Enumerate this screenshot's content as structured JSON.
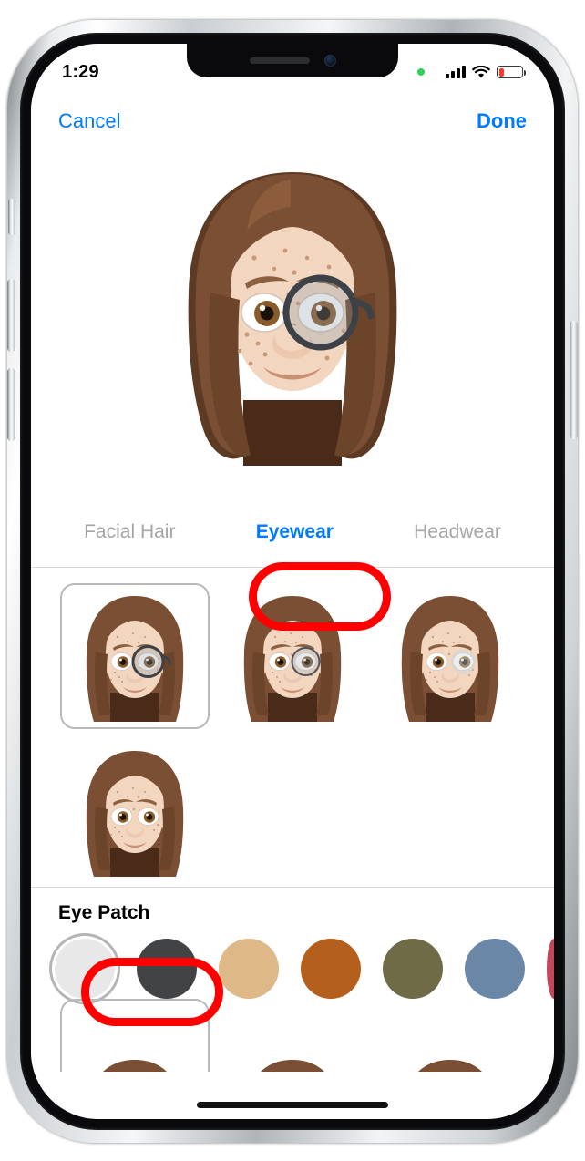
{
  "status_bar": {
    "time": "1:29",
    "recording_dot": "recording-indicator-dot",
    "signal_icon": "cellular-signal-icon",
    "wifi_icon": "wifi-icon",
    "battery_icon": "battery-low-icon",
    "battery_level_percent": 15
  },
  "nav": {
    "cancel_label": "Cancel",
    "done_label": "Done"
  },
  "avatar": {
    "name": "memoji-preview",
    "description": "Memoji with brown shoulder-length hair, freckles, and a dark round monocle eye patch over the right eye",
    "hair_color": "#7b4f33",
    "hair_shadow": "#5d3a24",
    "skin_color": "#f3d6c0",
    "skin_shadow": "#e0bca2",
    "freckle_color": "#c89878",
    "patch_color": "#3c4247"
  },
  "tabs": [
    {
      "label": "Facial Hair",
      "active": false
    },
    {
      "label": "Eyewear",
      "active": true
    },
    {
      "label": "Headwear",
      "active": false
    }
  ],
  "options": [
    {
      "name": "eyewear-option-1",
      "has_patch": true,
      "patch_side": "right",
      "selected": true
    },
    {
      "name": "eyewear-option-2",
      "has_patch": true,
      "patch_side": "right",
      "selected": false
    },
    {
      "name": "eyewear-option-3",
      "has_patch": false,
      "patch_side": "",
      "selected": false
    },
    {
      "name": "eyewear-option-4",
      "has_patch": false,
      "patch_side": "",
      "selected": false
    }
  ],
  "bottom_partial_row": [
    {
      "name": "eyewear-option-5",
      "selected": true
    },
    {
      "name": "eyewear-option-6",
      "selected": false
    },
    {
      "name": "eyewear-option-7",
      "selected": false
    }
  ],
  "eye_patch_section": {
    "label": "Eye Patch"
  },
  "colors": [
    {
      "name": "color-swatch-white",
      "hex": "#e8e8e8",
      "selected": true,
      "partial": false
    },
    {
      "name": "color-swatch-charcoal",
      "hex": "#414345",
      "selected": false,
      "partial": false
    },
    {
      "name": "color-swatch-tan",
      "hex": "#deb887",
      "selected": false,
      "partial": false
    },
    {
      "name": "color-swatch-orange",
      "hex": "#b4601c",
      "selected": false,
      "partial": false
    },
    {
      "name": "color-swatch-olive",
      "hex": "#6e6b46",
      "selected": false,
      "partial": false
    },
    {
      "name": "color-swatch-blue",
      "hex": "#6b87a8",
      "selected": false,
      "partial": false
    },
    {
      "name": "color-swatch-red",
      "hex": "#c0485a",
      "selected": false,
      "partial": true
    }
  ],
  "annotations": [
    {
      "name": "annotation-eyewear-tab",
      "color": "#ff0000",
      "target": "Eyewear"
    },
    {
      "name": "annotation-eye-patch-label",
      "color": "#ff0000",
      "target": "Eye Patch"
    }
  ],
  "accent_color": "#007aff",
  "home_indicator": "home-indicator"
}
